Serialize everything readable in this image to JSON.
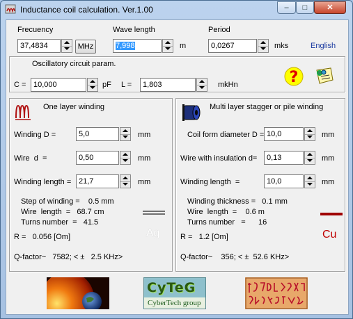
{
  "window": {
    "title": "Inductance coil calculation. Ver.1.00",
    "minimize": "–",
    "restore": "□",
    "close": "✕"
  },
  "top": {
    "frequency_label": "Frecuency",
    "frequency_value": "37,4834",
    "frequency_unit_button": "MHz",
    "wavelength_label": "Wave length",
    "wavelength_value": "7,998",
    "wavelength_unit": "m",
    "period_label": "Period",
    "period_value": "0,0267",
    "period_unit": "mks",
    "language": "English"
  },
  "oscillatory": {
    "title": "Oscillatory circuit param.",
    "c_label": "C =",
    "c_value": "10,000",
    "c_unit": "pF",
    "l_label": "L =",
    "l_value": "1,803",
    "l_unit": "mkHn"
  },
  "single": {
    "title": "One layer winding",
    "winding_d_label": "Winding D =",
    "winding_d_value": "5,0",
    "winding_d_unit": "mm",
    "wire_d_label": "Wire  d  =",
    "wire_d_value": "0,50",
    "wire_d_unit": "mm",
    "winding_length_label": "Winding length =",
    "winding_length_value": "21,7",
    "winding_length_unit": "mm",
    "step": "Step of winding =    0.5 mm",
    "wire_length": "Wire  length  =   68.7 cm",
    "turns": "Turns number  =   41.5",
    "r": "R =   0.056 [Om]",
    "q": "Q-factor~   7582; < ±   2.5 KHz>",
    "material": "Ag"
  },
  "multi": {
    "title": "Multi layer stagger or pile winding",
    "coil_form_label": "Coil form diameter D =",
    "coil_form_value": "10,0",
    "coil_form_unit": "mm",
    "wire_ins_label": "Wire with insulation d=",
    "wire_ins_value": "0,13",
    "wire_ins_unit": "mm",
    "winding_length_label": "Winding length  =",
    "winding_length_value": "10,0",
    "winding_length_unit": "mm",
    "thickness": "Winding thickness =   0.1 mm",
    "wire_length": "Wire  length  =    0.6 m",
    "turns": "Turns number   =      16",
    "r": "R =   1.2 [Om]",
    "q": "Q-factor~    356; < ±  52.6 KHz>",
    "material": "Cu"
  },
  "footer": {
    "logo_name": "CyTeG",
    "logo_sub": "CyberTech group"
  },
  "colors": {
    "accent_red": "#c00000",
    "help_yellow": "#ffff00",
    "link_blue": "#1a3aa0"
  }
}
